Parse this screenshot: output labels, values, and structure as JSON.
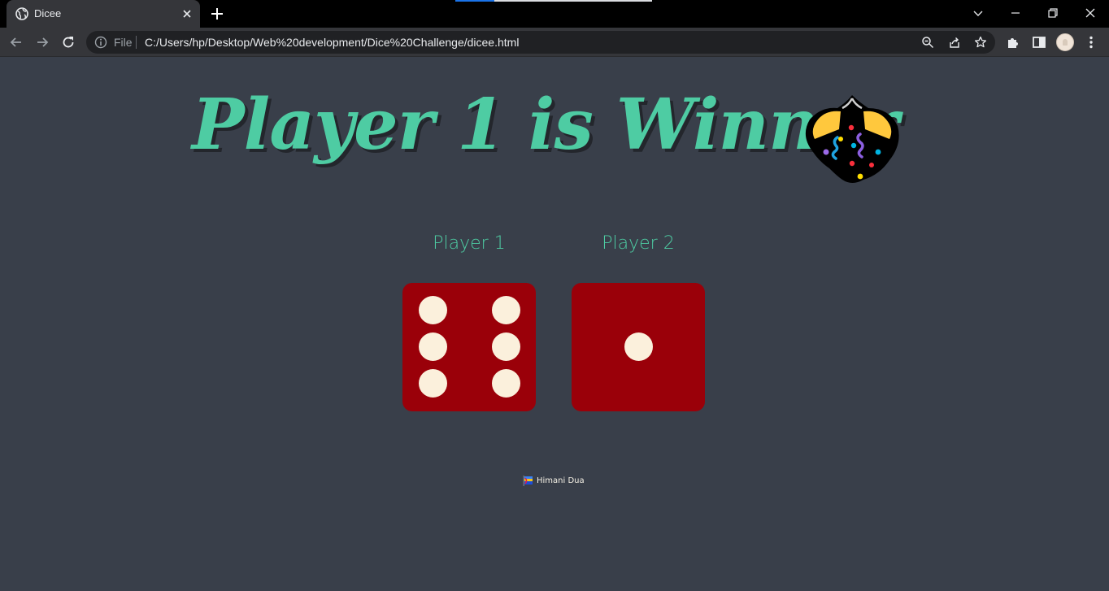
{
  "browser": {
    "tab": {
      "title": "Dicee",
      "favicon": "globe-icon"
    },
    "omnibox": {
      "scheme_label": "File",
      "url": "C:/Users/hp/Desktop/Web%20development/Dice%20Challenge/dicee.html"
    },
    "icons": [
      "back-arrow-icon",
      "forward-arrow-icon",
      "reload-icon",
      "info-icon",
      "zoom-out-icon",
      "share-icon",
      "bookmark-star-icon",
      "extensions-icon",
      "side-panel-icon",
      "profile-avatar",
      "menu-kebab-icon",
      "tab-search-icon",
      "minimize-icon",
      "restore-icon",
      "close-window-icon"
    ]
  },
  "page": {
    "headline": "Player 1 is Winner",
    "headline_emoji": "party-popper-emoji",
    "players": [
      {
        "label": "Player 1",
        "dice_value": 6
      },
      {
        "label": "Player 2",
        "dice_value": 1
      }
    ],
    "footer": {
      "icon": "rainbow-flag-icon",
      "text": "Himani Dua"
    }
  },
  "colors": {
    "background": "#393f4a",
    "accent": "#4ecca3",
    "dice": "#9a0009",
    "pip": "#fbf0dc"
  }
}
